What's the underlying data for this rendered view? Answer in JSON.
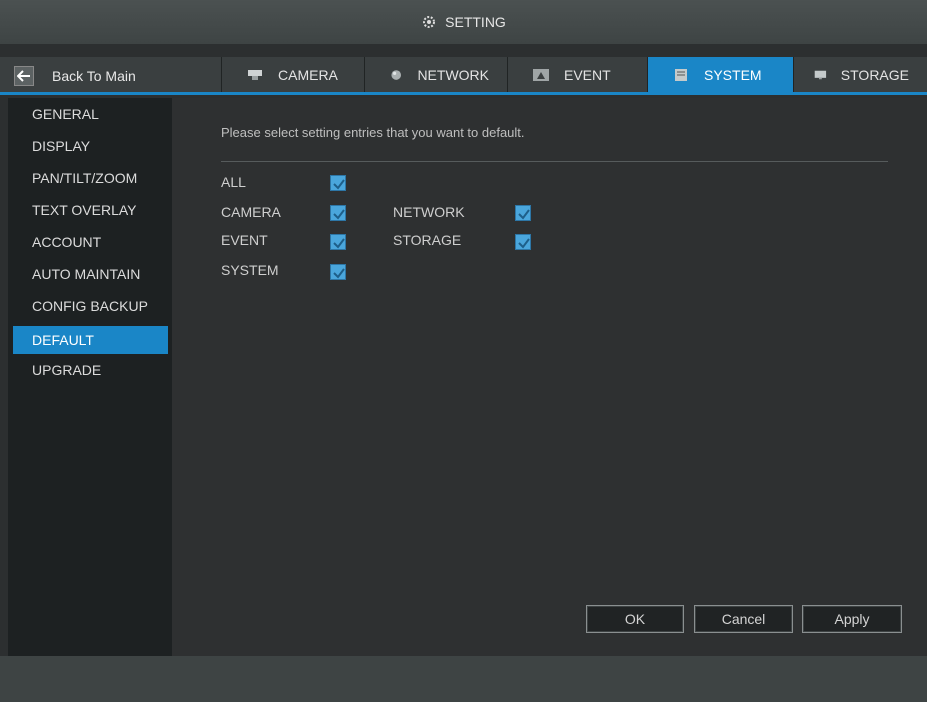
{
  "window": {
    "title": "SETTING"
  },
  "nav": {
    "back_label": "Back To Main",
    "tabs": [
      {
        "label": "CAMERA",
        "icon": "camera-icon",
        "active": false
      },
      {
        "label": "NETWORK",
        "icon": "network-icon",
        "active": false
      },
      {
        "label": "EVENT",
        "icon": "event-icon",
        "active": false
      },
      {
        "label": "SYSTEM",
        "icon": "system-icon",
        "active": true
      },
      {
        "label": "STORAGE",
        "icon": "storage-icon",
        "active": false
      }
    ]
  },
  "sidebar": {
    "items": [
      {
        "label": "GENERAL"
      },
      {
        "label": "DISPLAY"
      },
      {
        "label": "PAN/TILT/ZOOM"
      },
      {
        "label": "TEXT OVERLAY"
      },
      {
        "label": "ACCOUNT"
      },
      {
        "label": "AUTO MAINTAIN"
      },
      {
        "label": "CONFIG BACKUP"
      },
      {
        "label": "DEFAULT",
        "active": true
      },
      {
        "label": "UPGRADE"
      }
    ]
  },
  "main": {
    "prompt": "Please select setting entries that you want to default.",
    "options": {
      "all": {
        "label": "ALL",
        "checked": true
      },
      "camera": {
        "label": "CAMERA",
        "checked": true
      },
      "network": {
        "label": "NETWORK",
        "checked": true
      },
      "event": {
        "label": "EVENT",
        "checked": true
      },
      "storage": {
        "label": "STORAGE",
        "checked": true
      },
      "system": {
        "label": "SYSTEM",
        "checked": true
      }
    },
    "buttons": {
      "ok": "OK",
      "cancel": "Cancel",
      "apply": "Apply"
    }
  },
  "colors": {
    "accent": "#1a86c7",
    "checkbox": "#4aa6dc"
  }
}
